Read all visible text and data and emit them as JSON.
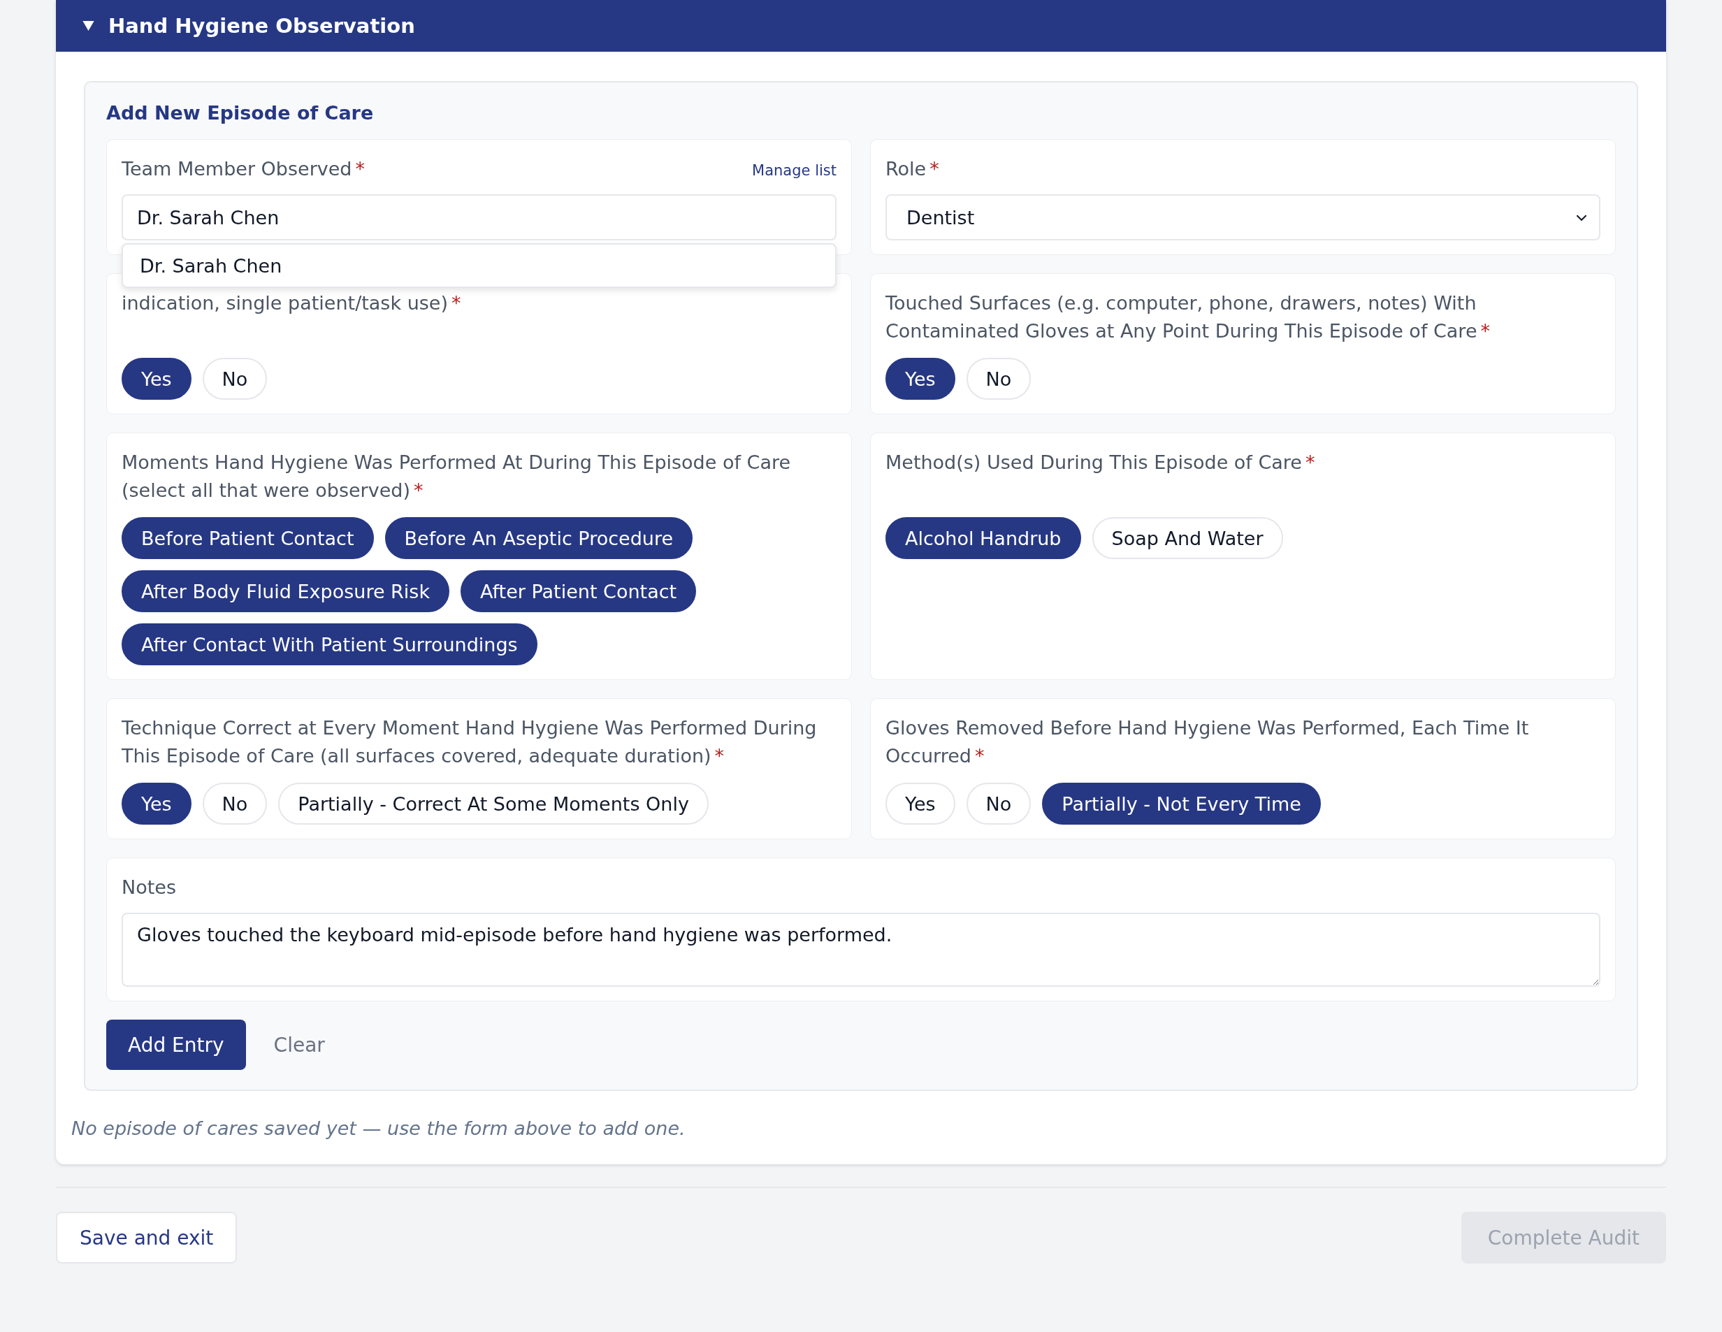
{
  "section": {
    "title": "Hand Hygiene Observation",
    "expanded": true
  },
  "form": {
    "title": "Add New Episode of Care",
    "required_mark": "*",
    "fields": [
      {
        "kind": "text",
        "label": "Team Member Observed",
        "required": true,
        "link": "Manage list",
        "value": "Dr. Sarah Chen",
        "suggestions": [
          "Dr. Sarah Chen"
        ]
      },
      {
        "kind": "select",
        "label": "Role",
        "required": true,
        "value": "Dentist"
      },
      {
        "kind": "choice",
        "label": "indication, single patient/task use)",
        "required": true,
        "options": [
          {
            "label": "Yes",
            "selected": true
          },
          {
            "label": "No",
            "selected": false
          }
        ]
      },
      {
        "kind": "choice",
        "label": "Touched Surfaces (e.g. computer, phone, drawers, notes) With Contaminated Gloves at Any Point During This Episode of Care",
        "required": true,
        "options": [
          {
            "label": "Yes",
            "selected": true
          },
          {
            "label": "No",
            "selected": false
          }
        ]
      },
      {
        "kind": "choice",
        "label": "Moments Hand Hygiene Was Performed At During This Episode of Care (select all that were observed)",
        "required": true,
        "options": [
          {
            "label": "Before Patient Contact",
            "selected": true
          },
          {
            "label": "Before An Aseptic Procedure",
            "selected": true
          },
          {
            "label": "After Body Fluid Exposure Risk",
            "selected": true
          },
          {
            "label": "After Patient Contact",
            "selected": true
          },
          {
            "label": "After Contact With Patient Surroundings",
            "selected": true
          }
        ]
      },
      {
        "kind": "choice",
        "label": "Method(s) Used During This Episode of Care",
        "required": true,
        "options": [
          {
            "label": "Alcohol Handrub",
            "selected": true
          },
          {
            "label": "Soap And Water",
            "selected": false
          }
        ]
      },
      {
        "kind": "choice",
        "label": "Technique Correct at Every Moment Hand Hygiene Was Performed During This Episode of Care (all surfaces covered, adequate duration)",
        "required": true,
        "options": [
          {
            "label": "Yes",
            "selected": true
          },
          {
            "label": "No",
            "selected": false
          },
          {
            "label": "Partially - Correct At Some Moments Only",
            "selected": false
          }
        ]
      },
      {
        "kind": "choice",
        "label": "Gloves Removed Before Hand Hygiene Was Performed, Each Time It Occurred",
        "required": true,
        "options": [
          {
            "label": "Yes",
            "selected": false
          },
          {
            "label": "No",
            "selected": false
          },
          {
            "label": "Partially - Not Every Time",
            "selected": true
          }
        ]
      },
      {
        "kind": "textarea",
        "label": "Notes",
        "required": false,
        "value": "Gloves touched the keyboard mid-episode before hand hygiene was performed."
      }
    ],
    "add_button": "Add Entry",
    "clear_button": "Clear"
  },
  "empty_message": "No episode of cares saved yet — use the form above to add one.",
  "footer": {
    "save_button": "Save and exit",
    "complete_button": {
      "label": "Complete Audit",
      "disabled": true
    }
  }
}
